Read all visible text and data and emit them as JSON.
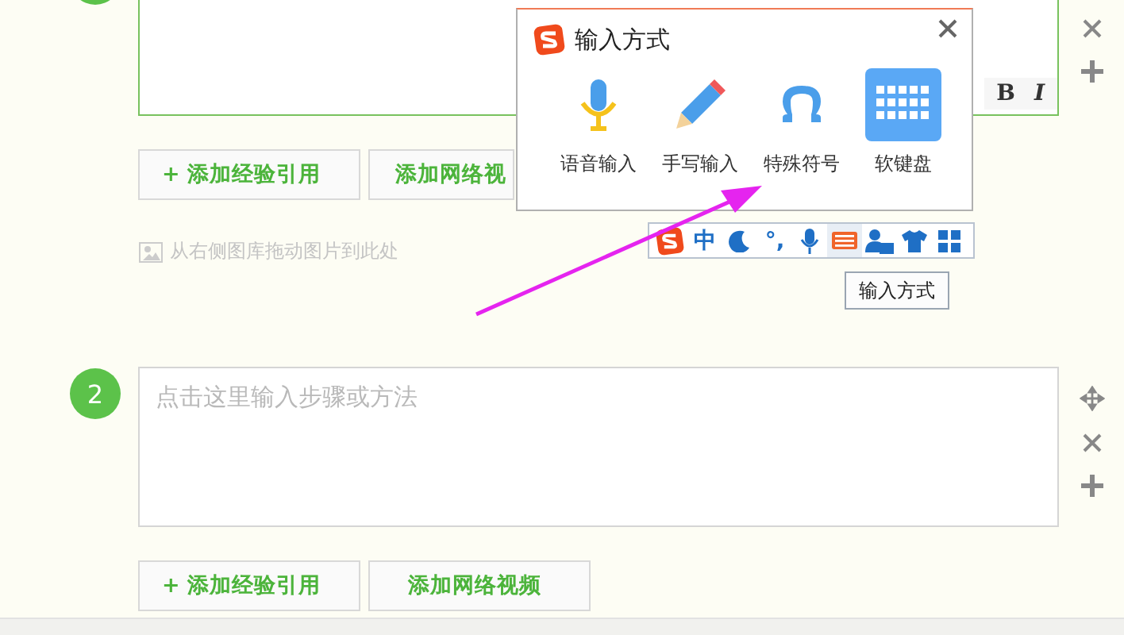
{
  "steps": [
    {
      "focused": true,
      "format_buttons": [
        "B",
        "I"
      ],
      "buttons": [
        {
          "label": "+ 添加经验引用",
          "kind": "add"
        },
        {
          "label": "添加网络视",
          "kind": "video"
        }
      ],
      "image_hint": "从右侧图库拖动图片到此处"
    },
    {
      "number": "2",
      "focused": false,
      "placeholder": "点击这里输入步骤或方法",
      "buttons": [
        {
          "label": "+ 添加经验引用",
          "kind": "add"
        },
        {
          "label": "添加网络视频",
          "kind": "video"
        }
      ]
    }
  ],
  "input_popup": {
    "title": "输入方式",
    "items": [
      {
        "label": "语音输入",
        "kind": "voice",
        "selected": false
      },
      {
        "label": "手写输入",
        "kind": "handwrite",
        "selected": false
      },
      {
        "label": "特殊符号",
        "kind": "symbol",
        "selected": false
      },
      {
        "label": "软键盘",
        "kind": "keyboard",
        "selected": true
      }
    ]
  },
  "ime_toolbar": {
    "items": [
      {
        "kind": "logo",
        "hovered": false
      },
      {
        "kind": "text",
        "text": "中",
        "hovered": false
      },
      {
        "kind": "moon",
        "hovered": false
      },
      {
        "kind": "text",
        "text": "°,",
        "hovered": false
      },
      {
        "kind": "mic",
        "hovered": false
      },
      {
        "kind": "keyboard",
        "hovered": true
      },
      {
        "kind": "user",
        "hovered": false
      },
      {
        "kind": "shirt",
        "hovered": false
      },
      {
        "kind": "grid",
        "hovered": false
      }
    ]
  },
  "tooltip": "输入方式"
}
